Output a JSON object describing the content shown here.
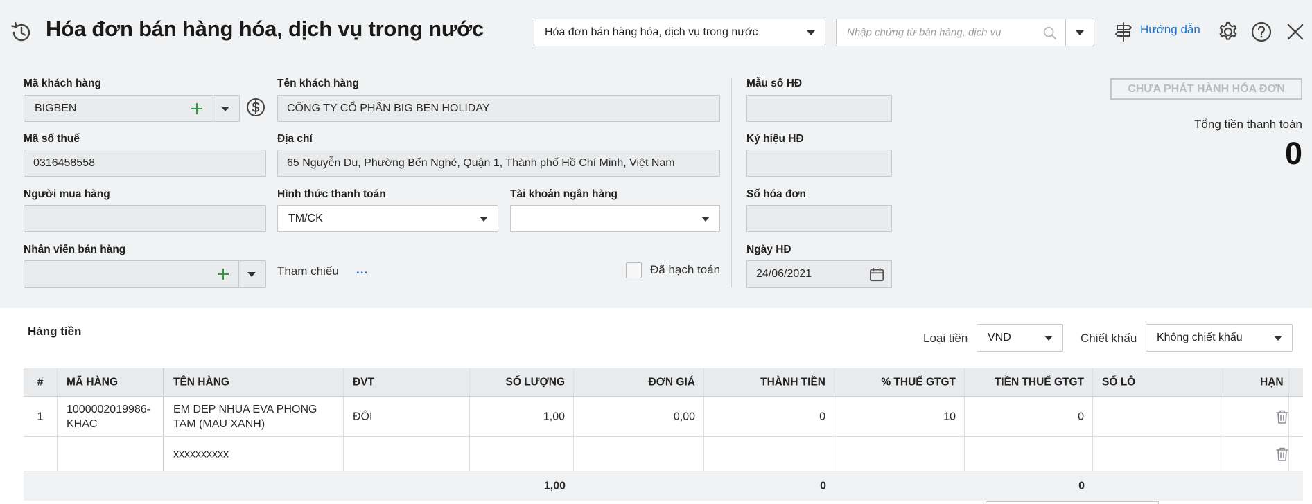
{
  "header": {
    "title": "Hóa đơn bán hàng hóa, dịch vụ trong nước",
    "type_select": "Hóa đơn bán hàng hóa, dịch vụ trong nước",
    "search_placeholder": "Nhập chứng từ bán hàng, dịch vụ",
    "help_label": "Hướng dẫn"
  },
  "form": {
    "customer_code": {
      "label": "Mã khách hàng",
      "value": "BIGBEN"
    },
    "customer_name": {
      "label": "Tên khách hàng",
      "value": "CÔNG TY CỔ PHẦN BIG BEN HOLIDAY"
    },
    "tax_code": {
      "label": "Mã số thuế",
      "value": "0316458558"
    },
    "address": {
      "label": "Địa chỉ",
      "value": "65 Nguyễn Du, Phường Bến Nghé, Quận 1, Thành phố Hồ Chí Minh, Việt Nam"
    },
    "buyer": {
      "label": "Người mua hàng",
      "value": ""
    },
    "payment_method": {
      "label": "Hình thức thanh toán",
      "value": "TM/CK"
    },
    "bank_account": {
      "label": "Tài khoản ngân hàng",
      "value": ""
    },
    "salesperson": {
      "label": "Nhân viên bán hàng",
      "value": ""
    },
    "reference": {
      "label": "Tham chiếu",
      "link": "..."
    },
    "posted": {
      "label": "Đã hạch toán",
      "checked": false
    },
    "invoice_template": {
      "label": "Mẫu số HĐ",
      "value": ""
    },
    "invoice_symbol": {
      "label": "Ký hiệu HĐ",
      "value": ""
    },
    "invoice_number": {
      "label": "Số hóa đơn",
      "value": ""
    },
    "invoice_date": {
      "label": "Ngày HĐ",
      "value": "24/06/2021"
    }
  },
  "status": {
    "publish_button": "CHƯA PHÁT HÀNH HÓA ĐƠN",
    "total_label": "Tổng tiền thanh toán",
    "total_value": "0"
  },
  "items_section": {
    "title": "Hàng tiền",
    "currency_label": "Loại tiền",
    "currency_value": "VND",
    "discount_label": "Chiết khấu",
    "discount_value": "Không chiết khấu"
  },
  "table": {
    "columns": [
      "#",
      "MÃ HÀNG",
      "TÊN HÀNG",
      "ĐVT",
      "SỐ LƯỢNG",
      "ĐƠN GIÁ",
      "THÀNH TIỀN",
      "% THUẾ GTGT",
      "TIỀN THUẾ GTGT",
      "SỐ LÔ",
      "HẠN"
    ],
    "rows": [
      {
        "no": "1",
        "code": "1000002019986-KHAC",
        "name": "EM DEP NHUA EVA PHONG TAM (MAU XANH)",
        "unit": "ĐÔI",
        "qty": "1,00",
        "price": "0,00",
        "amount": "0",
        "vat_rate": "10",
        "vat_amount": "0",
        "lot": "",
        "expiry": ""
      },
      {
        "no": "",
        "code": "",
        "name": "xxxxxxxxxx",
        "unit": "",
        "qty": "",
        "price": "",
        "amount": "",
        "vat_rate": "",
        "vat_amount": "",
        "lot": "",
        "expiry": ""
      }
    ],
    "totals": {
      "qty": "1,00",
      "amount": "0",
      "vat_amount": "0"
    }
  },
  "colors": {
    "accent_link": "#1a73c8",
    "plus_green": "#2e9a3e",
    "panel_bg": "#f1f2f3"
  },
  "icons": [
    "history-icon",
    "search-icon",
    "help-guide-icon",
    "gear-icon",
    "question-icon",
    "close-icon",
    "dollar-circle-icon",
    "calendar-icon",
    "trash-icon"
  ]
}
